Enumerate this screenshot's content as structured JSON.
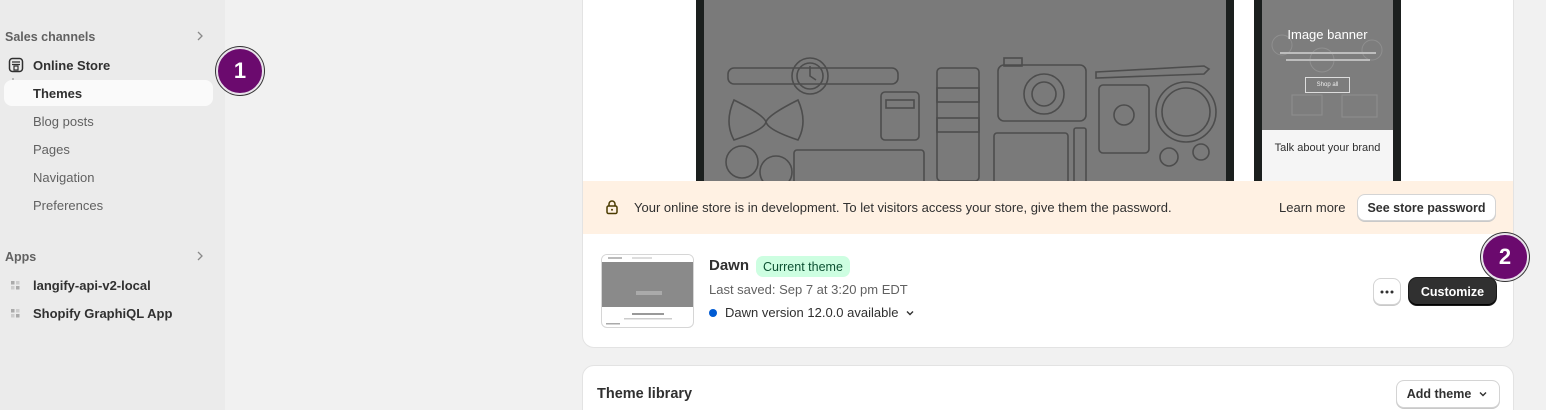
{
  "sidebar": {
    "sales_channels": "Sales channels",
    "online_store": "Online Store",
    "items": [
      "Themes",
      "Blog posts",
      "Pages",
      "Navigation",
      "Preferences"
    ],
    "apps_label": "Apps",
    "apps": [
      "langify-api-v2-local",
      "Shopify GraphiQL App"
    ]
  },
  "badges": {
    "one": "1",
    "two": "2"
  },
  "preview": {
    "mobile_banner_title": "Image banner",
    "mobile_banner_button": "Shop all",
    "mobile_talk": "Talk about your brand"
  },
  "dev_banner": {
    "text": "Your online store is in development. To let visitors access your store, give them the password.",
    "learn_more": "Learn more",
    "see_password": "See store password"
  },
  "current_theme": {
    "name": "Dawn",
    "badge": "Current theme",
    "last_saved": "Last saved: Sep 7 at 3:20 pm EDT",
    "version": "Dawn version 12.0.0 available",
    "customize": "Customize"
  },
  "library": {
    "title": "Theme library",
    "add_theme": "Add theme"
  },
  "colors": {
    "badge": "#6b0a6e",
    "primary_button": "#303030",
    "dev_banner_bg": "#fff1e3",
    "current_badge_bg": "#cdfee1",
    "version_dot": "#005bd3"
  }
}
